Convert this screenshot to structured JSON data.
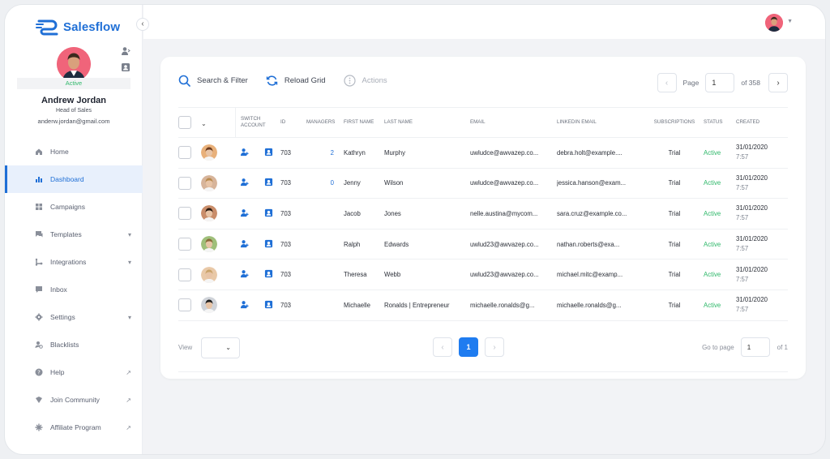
{
  "brand": {
    "name": "Salesflow",
    "color": "#1f6fd6"
  },
  "user": {
    "status": "Active",
    "name": "Andrew Jordan",
    "role": "Head of Sales",
    "email": "anderw.jordan@gmail.com"
  },
  "nav": [
    {
      "label": "Home",
      "icon": "home-icon",
      "active": false,
      "trail": ""
    },
    {
      "label": "Dashboard",
      "icon": "bar-chart-icon",
      "active": true,
      "trail": ""
    },
    {
      "label": "Campaigns",
      "icon": "grid-icon",
      "active": false,
      "trail": ""
    },
    {
      "label": "Templates",
      "icon": "chat-icon",
      "active": false,
      "trail": "chevron-down"
    },
    {
      "label": "Integrations",
      "icon": "integration-icon",
      "active": false,
      "trail": "chevron-down"
    },
    {
      "label": "Inbox",
      "icon": "inbox-icon",
      "active": false,
      "trail": ""
    },
    {
      "label": "Settings",
      "icon": "gear-icon",
      "active": false,
      "trail": "chevron-down"
    },
    {
      "label": "Blacklists",
      "icon": "blacklist-icon",
      "active": false,
      "trail": ""
    },
    {
      "label": "Help",
      "icon": "help-icon",
      "active": false,
      "trail": "external"
    },
    {
      "label": "Join Community",
      "icon": "community-icon",
      "active": false,
      "trail": "external"
    },
    {
      "label": "Affiliate Program",
      "icon": "affiliate-icon",
      "active": false,
      "trail": "external"
    }
  ],
  "toolbar": {
    "search_label": "Search & Filter",
    "reload_label": "Reload Grid",
    "actions_label": "Actions"
  },
  "pager_top": {
    "page_label": "Page",
    "page_value": "1",
    "of_label": "of 358"
  },
  "table": {
    "headers": {
      "switch": "SWITCH ACCOUNT",
      "id": "ID",
      "managers": "MANAGERS",
      "first": "FIRST NAME",
      "last": "LAST NAME",
      "email": "EMAIL",
      "linkedin": "LINKEDIN EMAIL",
      "subs": "SUBSCRIPTIONS",
      "status": "STATUS",
      "created": "CREATED"
    },
    "rows": [
      {
        "id": "703",
        "managers": "2",
        "first": "Kathryn",
        "last": "Murphy",
        "email": "uwludce@awvazep.co...",
        "linkedin": "debra.holt@example....",
        "sub": "Trial",
        "status": "Active",
        "date": "31/01/2020",
        "time": "7:57"
      },
      {
        "id": "703",
        "managers": "0",
        "first": "Jenny",
        "last": "Wilson",
        "email": "uwludce@awvazep.co...",
        "linkedin": "jessica.hanson@exam...",
        "sub": "Trial",
        "status": "Active",
        "date": "31/01/2020",
        "time": "7:57"
      },
      {
        "id": "703",
        "managers": "",
        "first": "Jacob",
        "last": "Jones",
        "email": "nelle.austina@mycom...",
        "linkedin": "sara.cruz@example.co...",
        "sub": "Trial",
        "status": "Active",
        "date": "31/01/2020",
        "time": "7:57"
      },
      {
        "id": "703",
        "managers": "",
        "first": "Ralph",
        "last": "Edwards",
        "email": "uwlud23@awvazep.co...",
        "linkedin": "nathan.roberts@exa...",
        "sub": "Trial",
        "status": "Active",
        "date": "31/01/2020",
        "time": "7:57"
      },
      {
        "id": "703",
        "managers": "",
        "first": "Theresa",
        "last": "Webb",
        "email": "uwlud23@awvazep.co...",
        "linkedin": "michael.mitc@examp...",
        "sub": "Trial",
        "status": "Active",
        "date": "31/01/2020",
        "time": "7:57"
      },
      {
        "id": "703",
        "managers": "",
        "first": "Michaelle",
        "last": "Ronalds | Entrepreneur",
        "email": "michaelle.ronalds@g...",
        "linkedin": "michaelle.ronalds@g...",
        "sub": "Trial",
        "status": "Active",
        "date": "31/01/2020",
        "time": "7:57"
      }
    ]
  },
  "footer": {
    "view_label": "View",
    "current_page": "1",
    "goto_label": "Go to page",
    "goto_value": "1",
    "of_label": "of 1"
  },
  "colors": {
    "accent": "#1f7cf0",
    "active_status": "#2fb86a",
    "avatar_bg": "#f0647a"
  }
}
